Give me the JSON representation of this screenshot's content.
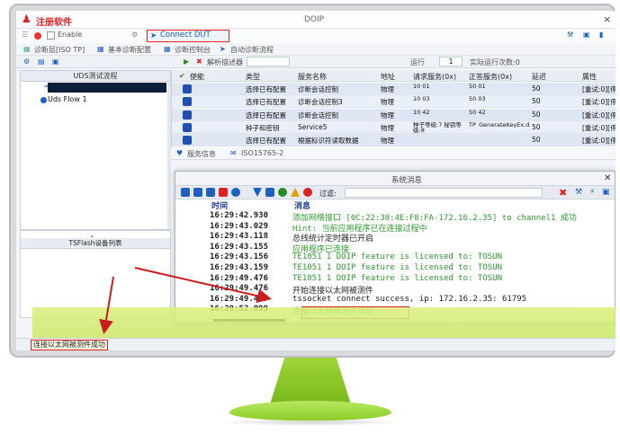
{
  "window": {
    "register_label": "注册软件",
    "title": "DOIP",
    "close": "×"
  },
  "toolbar1": {
    "enable": "Enable",
    "connect_dut": "Connect DUT"
  },
  "toolbar2": {
    "items": [
      "诊断层[ISO TP]",
      "基本诊断配置",
      "诊断控制台",
      "自动诊断流程"
    ]
  },
  "toolbar3": {
    "decoder": "解析描述器",
    "loop_label": "运行",
    "loop_value": "1",
    "realtime": "实际运行次数:0"
  },
  "left_panel": {
    "header": "UDS测试流程",
    "item": "Uds Flow 1",
    "bottom_header": "TSFlash设备列表"
  },
  "table": {
    "headers": [
      "使能",
      "类型",
      "服务名称",
      "地址",
      "请求服务(0x)",
      "正答服务(0x)",
      "延迟",
      "属性"
    ],
    "rows": [
      [
        "选择已有配置",
        "诊断会话控制",
        "物理",
        "10 01",
        "50 01",
        "50",
        "[重试:0][停止]"
      ],
      [
        "选择已有配置",
        "诊断会话控制3",
        "物理",
        "10 03",
        "50 03",
        "50",
        "[重试:0][停止]"
      ],
      [
        "选择已有配置",
        "诊断会话控制",
        "物理",
        "10 42",
        "50 42",
        "50",
        "[重试:0][停止]"
      ],
      [
        "种子和密钥",
        "Service5",
        "物理",
        "种子等级:7 秘钥等级:8",
        "TP_GenerateKeyEx.dll",
        "50",
        "[重试:0][停止]"
      ],
      [
        "选择已有配置",
        "根据标识符读取数据",
        "物理",
        "",
        "",
        "50",
        "[重试:0][停止]"
      ]
    ]
  },
  "service_tabs": [
    "服务信息",
    "ISO15765-2"
  ],
  "messages": {
    "title": "系统消息",
    "filter_label": "过滤:",
    "col_time": "时间",
    "col_msg": "消息",
    "logs": [
      {
        "time": "16:29:42.930",
        "msg": "添加网络接口 [0C:22:38:4E:F8:FA-172.16.2.35] to channel1 成功",
        "color": "green"
      },
      {
        "time": "16:29:43.029",
        "msg": "Hint: 当前应用程序已在连接过程中",
        "color": "green"
      },
      {
        "time": "16:29:43.118",
        "msg": "总线统计定时器已开启",
        "color": "dark"
      },
      {
        "time": "16:29:43.155",
        "msg": "应用程序已连接",
        "color": "green"
      },
      {
        "time": "16:29:43.156",
        "msg": "TE1051 1 DOIP feature is licensed to: TOSUN",
        "color": "green"
      },
      {
        "time": "16:29:43.159",
        "msg": "TE1051 1 DOIP feature is licensed to: TOSUN",
        "color": "green"
      },
      {
        "time": "16:29:49.476",
        "msg": "TE1051 1 DOIP feature is licensed to: TOSUN",
        "color": "green"
      },
      {
        "time": "16:29:49.476",
        "msg": "开始连接以太网被测件",
        "color": "dark"
      },
      {
        "time": "16:29:49.477",
        "msg": "tssocket connect success, ip: 172.16.2.35: 61795",
        "color": "dark"
      },
      {
        "time": "16:29:52.999",
        "msg": "连接以太网被测件成功",
        "color": "green"
      }
    ]
  },
  "status_bar": {
    "text": "连接以太网被测件成功"
  },
  "colors": {
    "accent": "#1f5fbf",
    "highlight": "#d22222",
    "monitor_green": "#8ccc28"
  }
}
